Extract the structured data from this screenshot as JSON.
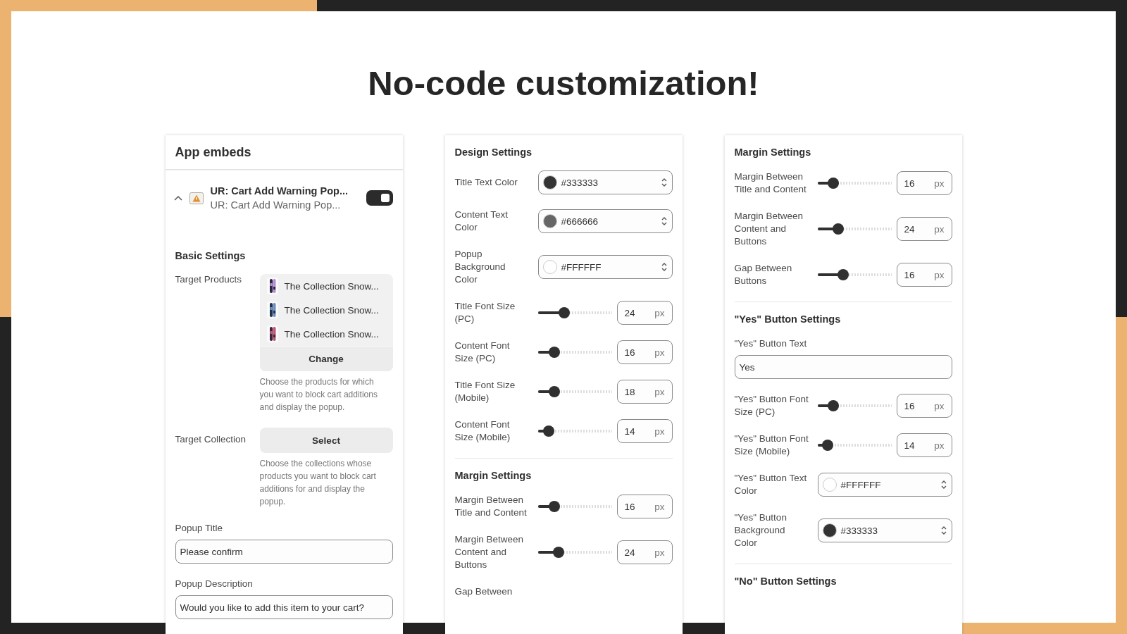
{
  "heading": "No-code customization!",
  "panels": [
    {
      "title": "App embeds",
      "embed": {
        "title": "UR: Cart Add Warning Pop...",
        "subtitle": "UR: Cart Add Warning Pop...",
        "on": true
      },
      "sections": [
        {
          "heading": "Basic Settings",
          "rows": [
            {
              "kind": "products",
              "label": "Target Products",
              "items": [
                "The Collection Snow...",
                "The Collection Snow...",
                "The Collection Snow..."
              ],
              "button": "Change",
              "help": "Choose the products for which you want to block cart additions and display the popup."
            },
            {
              "kind": "picker",
              "label": "Target Collection",
              "button": "Select",
              "help": "Choose the collections whose products you want to block cart additions for and display the popup."
            },
            {
              "kind": "text",
              "label": "Popup Title",
              "value": "Please confirm"
            },
            {
              "kind": "text",
              "label": "Popup Description",
              "value": "Would you like to add this item to your cart?"
            }
          ]
        }
      ]
    },
    {
      "sections": [
        {
          "heading": "Design Settings",
          "rows": [
            {
              "kind": "color",
              "label": "Title Text Color",
              "value": "#333333",
              "color": "#333333"
            },
            {
              "kind": "color",
              "label": "Content Text Color",
              "value": "#666666",
              "color": "#666666"
            },
            {
              "kind": "color",
              "label": "Popup Background Color",
              "value": "#FFFFFF",
              "color": "#ffffff"
            },
            {
              "kind": "slider",
              "label": "Title Font Size (PC)",
              "level": 0.36,
              "value": "24",
              "unit": "px"
            },
            {
              "kind": "slider",
              "label": "Content Font Size (PC)",
              "level": 0.22,
              "value": "16",
              "unit": "px"
            },
            {
              "kind": "slider",
              "label": "Title Font Size (Mobile)",
              "level": 0.22,
              "value": "18",
              "unit": "px"
            },
            {
              "kind": "slider",
              "label": "Content Font Size (Mobile)",
              "level": 0.15,
              "value": "14",
              "unit": "px"
            }
          ]
        },
        {
          "heading": "Margin Settings",
          "rows": [
            {
              "kind": "slider",
              "label": "Margin Between Title and Content",
              "level": 0.22,
              "value": "16",
              "unit": "px"
            },
            {
              "kind": "slider",
              "label": "Margin Between Content and Buttons",
              "level": 0.28,
              "value": "24",
              "unit": "px"
            },
            {
              "kind": "label",
              "label": "Gap Between"
            }
          ]
        }
      ]
    },
    {
      "sections": [
        {
          "heading": "Margin Settings",
          "rows": [
            {
              "kind": "slider",
              "label": "Margin Between Title and Content",
              "level": 0.21,
              "value": "16",
              "unit": "px"
            },
            {
              "kind": "slider",
              "label": "Margin Between Content and Buttons",
              "level": 0.28,
              "value": "24",
              "unit": "px"
            },
            {
              "kind": "slider",
              "label": "Gap Between Buttons",
              "level": 0.35,
              "value": "16",
              "unit": "px"
            }
          ]
        },
        {
          "heading": "\"Yes\" Button Settings",
          "rows": [
            {
              "kind": "text",
              "label": "\"Yes\" Button Text",
              "value": "Yes"
            },
            {
              "kind": "slider",
              "label": "\"Yes\" Button Font Size (PC)",
              "level": 0.21,
              "value": "16",
              "unit": "px"
            },
            {
              "kind": "slider",
              "label": "\"Yes\" Button Font Size (Mobile)",
              "level": 0.14,
              "value": "14",
              "unit": "px"
            },
            {
              "kind": "color",
              "label": "\"Yes\" Button Text Color",
              "value": "#FFFFFF",
              "color": "#ffffff"
            },
            {
              "kind": "color",
              "label": "\"Yes\" Button Background Color",
              "value": "#333333",
              "color": "#333333"
            }
          ]
        },
        {
          "heading": "\"No\" Button Settings"
        }
      ]
    }
  ]
}
